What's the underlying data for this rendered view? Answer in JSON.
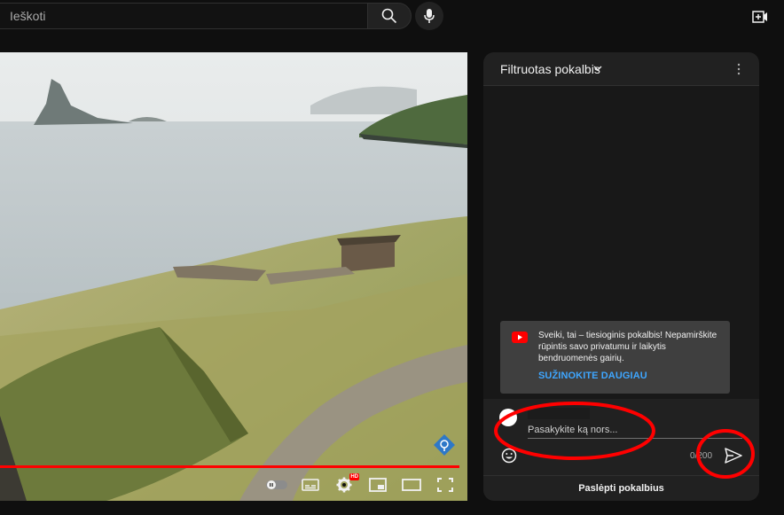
{
  "search": {
    "placeholder": "Ieškoti",
    "icon": "search-icon",
    "mic_icon": "mic-icon",
    "create_icon": "create-video-icon"
  },
  "player": {
    "progress_percent": 100,
    "hd_badge": "HD",
    "controls": [
      "autoplay-toggle-icon",
      "subtitles-icon",
      "settings-icon",
      "miniplayer-icon",
      "theater-mode-icon",
      "fullscreen-icon"
    ]
  },
  "chat": {
    "title": "Filtruotas pokalbis",
    "notice": {
      "text": "Sveiki, tai – tiesioginis pokalbis! Nepamirškite rūpintis savo privatumu ir laikytis bendruomenės gairių.",
      "link": "SUŽINOKITE DAUGIAU"
    },
    "input_placeholder": "Pasakykite ką nors...",
    "char_count": "0/200",
    "hide_label": "Paslėpti pokalbius"
  },
  "colors": {
    "accent_red": "#ff0000",
    "link_blue": "#3ea6ff",
    "background": "#0f0f0f",
    "panel": "#212121"
  }
}
